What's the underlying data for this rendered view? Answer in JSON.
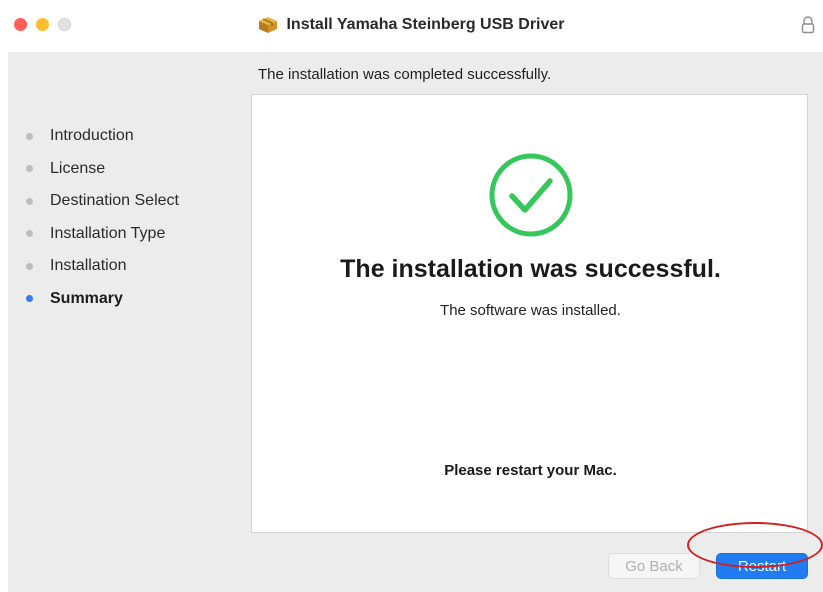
{
  "window": {
    "title": "Install Yamaha Steinberg USB Driver"
  },
  "heading": "The installation was completed successfully.",
  "steps": [
    {
      "label": "Introduction",
      "active": false
    },
    {
      "label": "License",
      "active": false
    },
    {
      "label": "Destination Select",
      "active": false
    },
    {
      "label": "Installation Type",
      "active": false
    },
    {
      "label": "Installation",
      "active": false
    },
    {
      "label": "Summary",
      "active": true
    }
  ],
  "panel": {
    "title": "The installation was successful.",
    "subtitle": "The software was installed.",
    "note": "Please restart your Mac."
  },
  "buttons": {
    "back": "Go Back",
    "restart": "Restart"
  },
  "colors": {
    "accent": "#1f7cf3",
    "success": "#34c759",
    "annotation": "#d31f1f"
  },
  "icons": {
    "title": "package-icon",
    "lock": "lock-icon",
    "status": "checkmark-circle-icon"
  }
}
